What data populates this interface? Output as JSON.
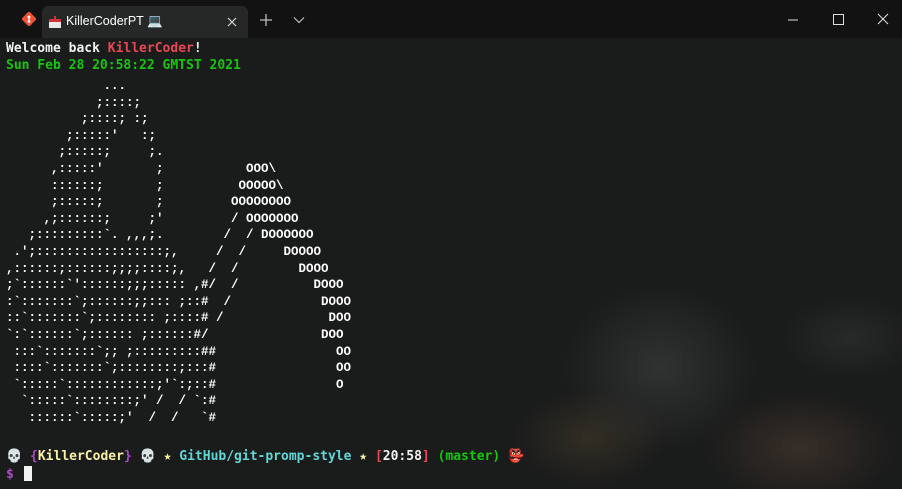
{
  "window": {
    "tab_title": "KillerCoderPT 💻",
    "icons": {
      "app_logo": "git-logo-icon",
      "tab_icon": "red-box-icon",
      "tab_close": "close-icon",
      "new_tab": "plus-icon",
      "dropdown": "chevron-down-icon",
      "minimize": "minimize-icon",
      "maximize": "maximize-icon",
      "close": "close-icon"
    }
  },
  "terminal": {
    "welcome_prefix": "Welcome back ",
    "welcome_user": "KillerCoder",
    "welcome_suffix": "!",
    "datetime": "Sun Feb 28 20:58:22 GMTST 2021",
    "ascii_art": "             ...\n            ;::::;\n          ;::::; :;\n        ;:::::'   :;\n       ;:::::;     ;.\n      ,:::::'       ;           OOO\\\n      ::::::;       ;          OOOOO\\\n      ;:::::;       ;         OOOOOOOO\n     ,;::::::;     ;'         / OOOOOOO\n   ;:::::::::`. ,,,;.        /  / DOOOOOO\n .';:::::::::::::::::;,     /  /     DOOOO\n,::::::;::::::;;;;::::;,   /  /        DOOO\n;`::::::`'::::::;;;::::: ,#/  /          DOOO\n:`:::::::`;::::::;;::: ;::#  /            DOOO\n::`:::::::`;:::::::: ;::::# /              DOO\n`:`::::::`;:::::: ;::::::#/               DOO\n :::`:::::::`;; ;:::::::::##                OO\n ::::`:::::::`;::::::::;:::#                OO\n `:::::`::::::::::::;'`:;::#                O\n  `:::::`::::::::;' /  / `:#\n   ::::::`:::::;'  /  /   `#",
    "prompt": {
      "skull_left": "💀",
      "open_brace": "{",
      "user": "KillerCoder",
      "close_brace": "}",
      "skull_mid": "💀",
      "star_left": "★",
      "repo_path": "GitHub/git-promp-style",
      "star_right": "★",
      "open_bracket": "[",
      "time": "20:58",
      "close_bracket": "]",
      "branch": "(master)",
      "tail_icon": "👺",
      "input_symbol": "$"
    },
    "colors": {
      "user": "#e74856",
      "date": "#16c60c",
      "repo": "#61d6d6",
      "star": "#f9f1a5",
      "prompt_symbol": "#b148c6"
    }
  }
}
